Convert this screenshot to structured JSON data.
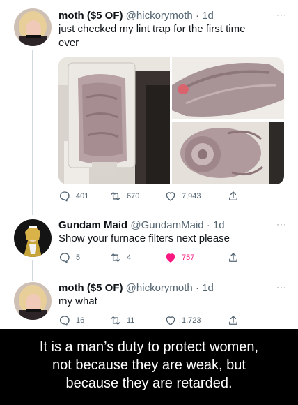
{
  "tweets": [
    {
      "name": "moth ($5 OF)",
      "handle": "@hickorymoth",
      "time": "· 1d",
      "text": [
        "just checked my lint trap for the first time",
        "ever"
      ],
      "replies": "401",
      "retweets": "670",
      "likes": "7,943",
      "liked": false
    },
    {
      "name": "Gundam Maid",
      "handle": "@GundamMaid",
      "time": "· 1d",
      "text": [
        "Show your furnace filters next please"
      ],
      "replies": "5",
      "retweets": "4",
      "likes": "757",
      "liked": true
    },
    {
      "name": "moth ($5 OF)",
      "handle": "@hickorymoth",
      "time": "· 1d",
      "text": [
        "my what"
      ],
      "replies": "16",
      "retweets": "11",
      "likes": "1,723",
      "liked": false
    }
  ],
  "caption": {
    "lines": [
      "It is a man’s duty to protect women,",
      "not because they are weak, but",
      "because they are retarded."
    ]
  },
  "icons": {
    "more": "more-dots-icon",
    "reply": "reply-bubble-icon",
    "retweet": "retweet-icon",
    "like": "heart-icon",
    "share": "share-icon"
  },
  "colors": {
    "like_active": "#f91880",
    "muted": "#536471",
    "caption_background": "#000000"
  }
}
